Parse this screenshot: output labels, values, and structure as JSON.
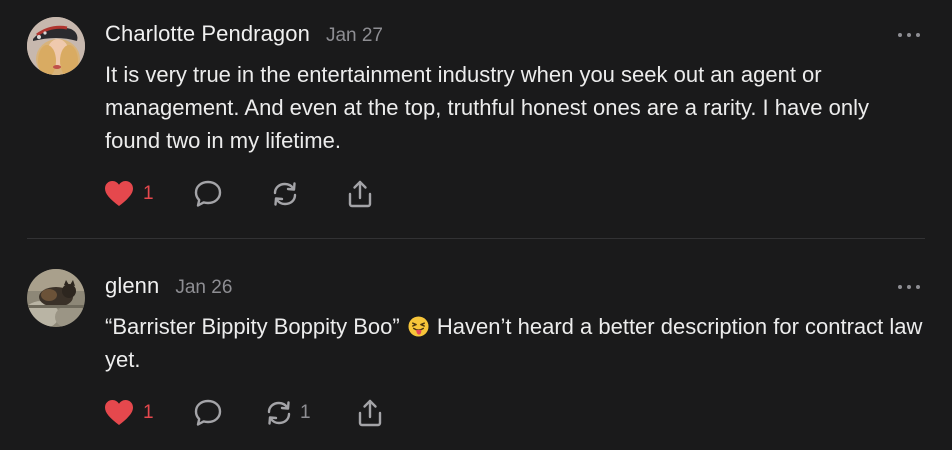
{
  "comments": [
    {
      "author": "Charlotte Pendragon",
      "date": "Jan 27",
      "text": "It is very true in the entertainment industry when you seek out an agent or management. And even at the top, truthful honest ones are a rarity. I have only found two in my lifetime.",
      "like_count": "1",
      "restack_count": "",
      "liked": true,
      "icons": [
        "heart-icon",
        "comment-bubble-icon",
        "restack-icon",
        "share-icon",
        "more-icon"
      ]
    },
    {
      "author": "glenn",
      "date": "Jan 26",
      "text_before_emoji": "“Barrister Bippity Boppity Boo”",
      "emoji": "😝",
      "text_after_emoji": "Haven’t heard a better description for contract law yet.",
      "like_count": "1",
      "restack_count": "1",
      "liked": true,
      "icons": [
        "heart-icon",
        "comment-bubble-icon",
        "restack-icon",
        "share-icon",
        "more-icon"
      ]
    }
  ],
  "colors": {
    "background": "#1a1a1b",
    "text": "#ececec",
    "muted": "#8e8e93",
    "like": "#e5484d",
    "divider": "#323234"
  }
}
